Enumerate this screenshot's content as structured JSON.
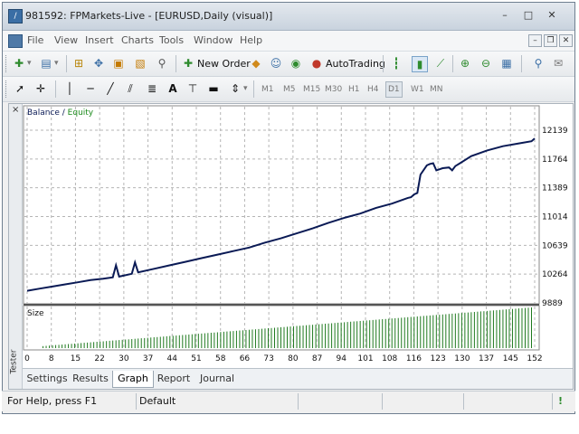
{
  "window": {
    "title": "981592: FPMarkets-Live - [EURUSD,Daily (visual)]",
    "minimize": "–",
    "maximize": "□",
    "close": "✕"
  },
  "menubar": {
    "items": [
      "File",
      "View",
      "Insert",
      "Charts",
      "Tools",
      "Window",
      "Help"
    ],
    "mdi_minimize": "–",
    "mdi_restore": "❐",
    "mdi_close": "✕"
  },
  "toolbar": {
    "new_order": "New Order",
    "auto_trading": "AutoTrading",
    "text_tool": "A",
    "timeframes": [
      "M1",
      "M5",
      "M15",
      "M30",
      "H1",
      "H4",
      "D1",
      "W1",
      "MN"
    ]
  },
  "tester": {
    "close": "×",
    "label": "Tester",
    "tabs": [
      "Settings",
      "Results",
      "Graph",
      "Report",
      "Journal"
    ],
    "active_tab": "Graph"
  },
  "chart_data": {
    "type": "line",
    "legend": [
      "Balance",
      "Equity"
    ],
    "legend_separator": " / ",
    "series_colors": {
      "Balance": "#0a1a55",
      "Equity": "#1a8a1a",
      "Size": "#1f7a1f"
    },
    "y_ticks": [
      "12139",
      "11764",
      "11389",
      "11014",
      "10639",
      "10264",
      "9889"
    ],
    "ylim": [
      9889,
      12326
    ],
    "x_ticks": [
      "0",
      "8",
      "15",
      "22",
      "30",
      "37",
      "44",
      "51",
      "58",
      "66",
      "73",
      "80",
      "87",
      "94",
      "101",
      "108",
      "116",
      "123",
      "130",
      "137",
      "145",
      "152"
    ],
    "xlim": [
      0,
      160
    ],
    "balance": [
      [
        0,
        10060
      ],
      [
        4,
        10090
      ],
      [
        8,
        10120
      ],
      [
        12,
        10150
      ],
      [
        16,
        10180
      ],
      [
        20,
        10210
      ],
      [
        24,
        10230
      ],
      [
        27,
        10250
      ],
      [
        28,
        10420
      ],
      [
        29,
        10260
      ],
      [
        33,
        10300
      ],
      [
        34,
        10460
      ],
      [
        35,
        10320
      ],
      [
        40,
        10370
      ],
      [
        45,
        10420
      ],
      [
        50,
        10470
      ],
      [
        55,
        10520
      ],
      [
        60,
        10570
      ],
      [
        65,
        10620
      ],
      [
        70,
        10670
      ],
      [
        75,
        10740
      ],
      [
        80,
        10800
      ],
      [
        85,
        10870
      ],
      [
        90,
        10940
      ],
      [
        95,
        11020
      ],
      [
        100,
        11090
      ],
      [
        105,
        11150
      ],
      [
        110,
        11230
      ],
      [
        115,
        11290
      ],
      [
        120,
        11370
      ],
      [
        121,
        11380
      ],
      [
        122,
        11420
      ],
      [
        123,
        11440
      ],
      [
        124,
        11700
      ],
      [
        126,
        11830
      ],
      [
        127,
        11850
      ],
      [
        128,
        11860
      ],
      [
        129,
        11760
      ],
      [
        131,
        11790
      ],
      [
        133,
        11800
      ],
      [
        134,
        11760
      ],
      [
        135,
        11820
      ],
      [
        140,
        11960
      ],
      [
        145,
        12040
      ],
      [
        150,
        12100
      ],
      [
        155,
        12140
      ],
      [
        159,
        12170
      ],
      [
        160,
        12210
      ]
    ],
    "size_label": "Size",
    "size": {
      "start_bar": 5,
      "bar_count": 155,
      "min": 0.05,
      "max": 1.0
    }
  },
  "statusbar": {
    "help": "For Help, press F1",
    "profile": "Default",
    "indicator": "!"
  }
}
